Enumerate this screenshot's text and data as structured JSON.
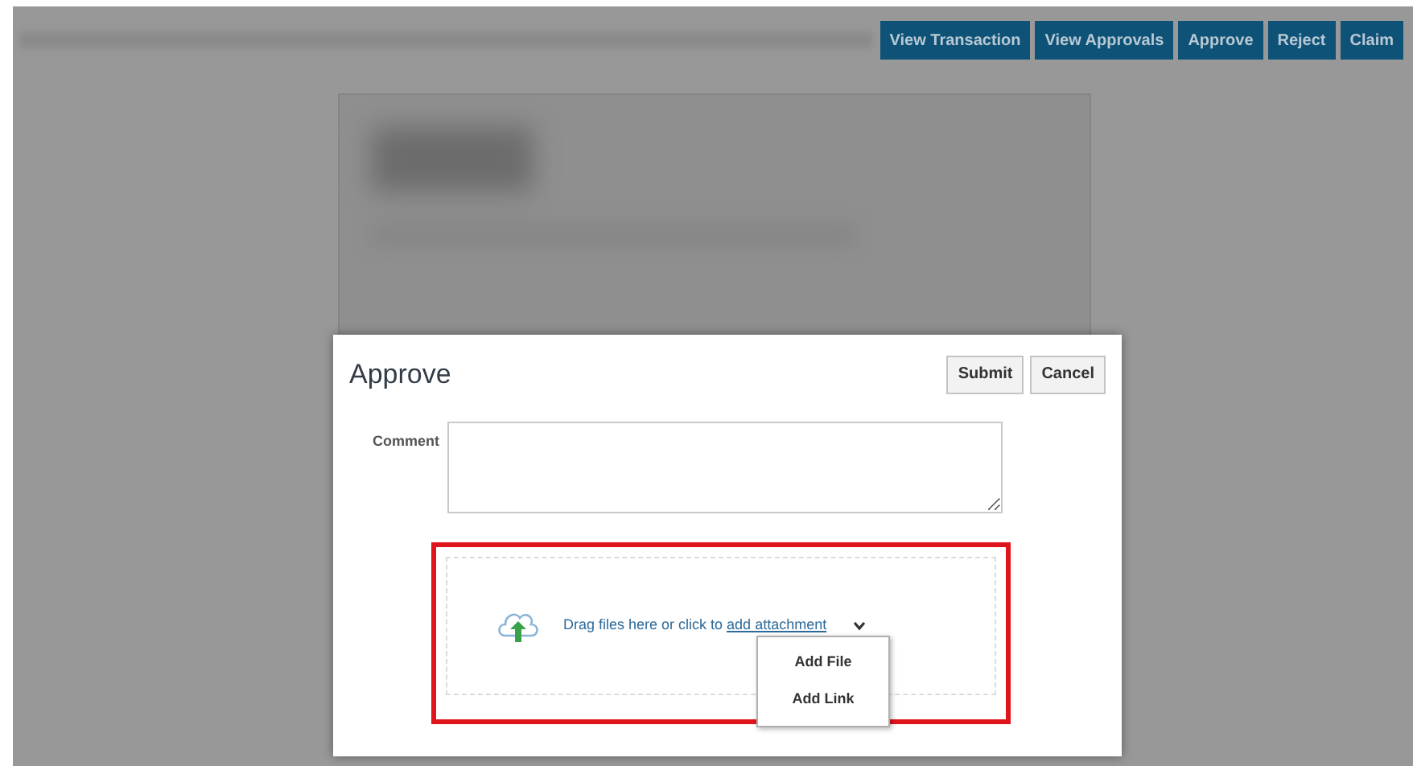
{
  "toolbar": {
    "buttons": [
      "View Transaction",
      "View Approvals",
      "Approve",
      "Reject",
      "Claim"
    ]
  },
  "dialog": {
    "title": "Approve",
    "buttons": [
      "Submit",
      "Cancel"
    ],
    "comment": {
      "label": "Comment"
    },
    "attachment": {
      "prompt": "Drag files here or click to ",
      "link": "add attachment",
      "menu_open": true,
      "menu": [
        "Add File",
        "Add Link"
      ]
    }
  }
}
